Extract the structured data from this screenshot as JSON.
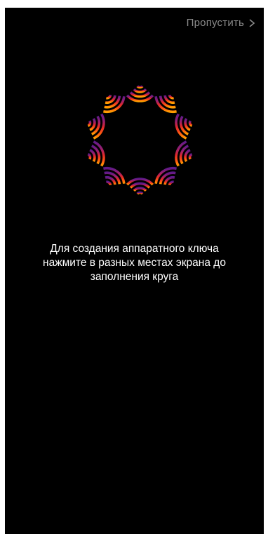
{
  "header": {
    "skip_label": "Пропустить",
    "skip_icon": "chevron-right-icon"
  },
  "main": {
    "progress_ring_icon": "segmented-ring-icon",
    "instruction_lines": [
      "Для создания аппаратного ключа",
      "нажмите в разных местах экрана до",
      "заполнения круга"
    ]
  },
  "colors": {
    "background": "#000000",
    "skip_text": "#8a8a8a",
    "instruction_text": "#ffffff",
    "ring_top": "#6a1a8a",
    "ring_bottom": "#ff9a00"
  }
}
